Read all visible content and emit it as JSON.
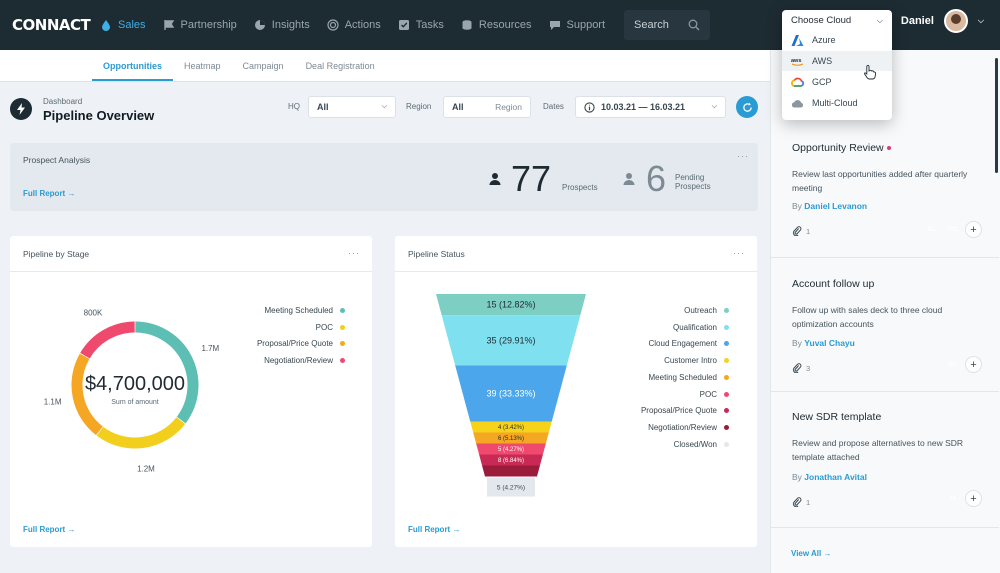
{
  "nav": {
    "logo": "CONNACT",
    "items": [
      {
        "label": "Sales",
        "icon": "drop-icon",
        "active": true
      },
      {
        "label": "Partnership",
        "icon": "flag-icon"
      },
      {
        "label": "Insights",
        "icon": "pie-icon"
      },
      {
        "label": "Actions",
        "icon": "target-icon"
      },
      {
        "label": "Tasks",
        "icon": "checkbox-icon"
      },
      {
        "label": "Resources",
        "icon": "database-icon"
      },
      {
        "label": "Support",
        "icon": "chat-icon"
      }
    ],
    "search_label": "Search",
    "user_name": "Daniel"
  },
  "subtabs": [
    "Opportunities",
    "Heatmap",
    "Campaign",
    "Deal Registration"
  ],
  "header": {
    "breadcrumb": "Dashboard",
    "title": "Pipeline Overview",
    "filters": {
      "hq_label": "HQ",
      "hq_value": "All",
      "region_label": "Region",
      "region_value": "All",
      "region_placeholder": "Region",
      "dates_label": "Dates",
      "dates_value": "10.03.21 — 16.03.21"
    }
  },
  "prospect": {
    "title": "Prospect Analysis",
    "link": "Full Report →",
    "prospects_value": "77",
    "prospects_label": "Prospects",
    "pending_value": "6",
    "pending_label_1": "Pending",
    "pending_label_2": "Prospects",
    "more": "···"
  },
  "pipeline_stage": {
    "title": "Pipeline by Stage",
    "link": "Full Report →",
    "more": "···",
    "chart_data": {
      "type": "pie",
      "total": "$4,700,000",
      "center_label": "Sum of amount",
      "segments": [
        {
          "name": "Meeting Scheduled",
          "value": 1.7,
          "label": "1.7M",
          "color": "#5dbfb3"
        },
        {
          "name": "POC",
          "value": 1.2,
          "label": "1.2M",
          "color": "#f2cf1d"
        },
        {
          "name": "Proposal/Price Quote",
          "value": 1.1,
          "label": "1.1M",
          "color": "#f5a623"
        },
        {
          "name": "Negotiation/Review",
          "value": 0.8,
          "label": "800K",
          "color": "#ef4a6e"
        }
      ]
    }
  },
  "pipeline_status": {
    "title": "Pipeline Status",
    "link": "Full Report →",
    "more": "···",
    "chart_data": {
      "type": "bar",
      "stages": [
        {
          "name": "Outreach",
          "label": "15 (12.82%)",
          "color": "#7ecfc3"
        },
        {
          "name": "Qualification",
          "label": "35  (29.91%)",
          "color": "#7fe0ef"
        },
        {
          "name": "Cloud Engagement",
          "label": "39 (33.33%)",
          "color": "#4ca6ec"
        },
        {
          "name": "Customer Intro",
          "label": "4 (3.42%)",
          "color": "#f7d21a"
        },
        {
          "name": "Meeting Scheduled",
          "label": "6 (5.13%)",
          "color": "#f5a623"
        },
        {
          "name": "POC",
          "label": "5 (4.27%)",
          "color": "#ef4a6e"
        },
        {
          "name": "Proposal/Price Quote",
          "label": "8 (6.84%)",
          "color": "#c92a55"
        },
        {
          "name": "Negotiation/Review",
          "label": "",
          "color": "#9b1b3b"
        },
        {
          "name": "Closed/Won",
          "label": "5 (4.27%)",
          "color": "#e3e8ee"
        }
      ],
      "values": [
        15,
        35,
        39,
        4,
        6,
        5,
        8,
        0,
        5
      ]
    }
  },
  "right_panel": {
    "cards": [
      {
        "title": "Opportunity Review",
        "desc": "Review last opportunities added after quarterly meeting",
        "by_label": "By",
        "by": "Daniel Levanon",
        "attachments": "1",
        "chips": [
          {
            "t": "DL",
            "c": "#4cb8b0"
          },
          {
            "t": "YC",
            "c": "#ef4a6e"
          }
        ]
      },
      {
        "title": "Account follow up",
        "desc": "Follow up with sales deck to three cloud optimization accounts",
        "by_label": "By",
        "by": "Yuval Chayu",
        "attachments": "3",
        "chips": [
          {
            "t": "DL",
            "c": "#4cb8b0"
          }
        ]
      },
      {
        "title": "New SDR template",
        "desc": "Review and propose alternatives to new SDR template attached",
        "by_label": "By",
        "by": "Jonathan Avital",
        "attachments": "1",
        "chips": [
          {
            "t": "JA",
            "c": "#f2c41a"
          }
        ]
      }
    ],
    "view_all": "View All →",
    "plus": "+"
  },
  "dropdown": {
    "label": "Choose Cloud",
    "options": [
      {
        "label": "Azure",
        "icon": "azure-icon"
      },
      {
        "label": "AWS",
        "icon": "aws-icon",
        "hover": true
      },
      {
        "label": "GCP",
        "icon": "gcp-icon"
      },
      {
        "label": "Multi-Cloud",
        "icon": "cloud-icon"
      }
    ]
  },
  "colors": {
    "brand": "#1d2b33",
    "accent": "#2a9bd3"
  }
}
